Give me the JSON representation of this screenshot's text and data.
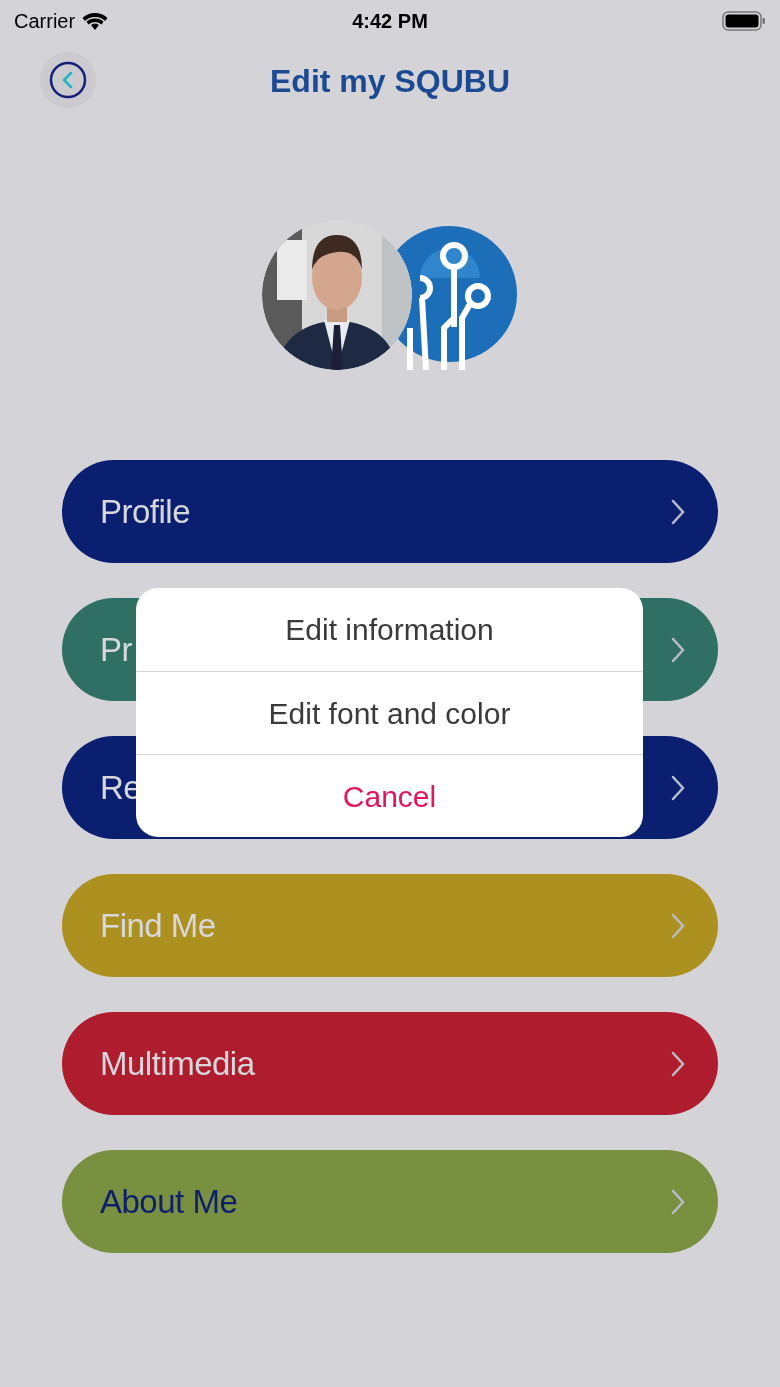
{
  "status_bar": {
    "carrier": "Carrier",
    "time": "4:42 PM"
  },
  "header": {
    "title": "Edit my SQUBU"
  },
  "menu": [
    {
      "label": "Profile",
      "color": "#0b1f70",
      "dark_label": false
    },
    {
      "label": "Pr",
      "color": "#2f6f64",
      "dark_label": false
    },
    {
      "label": "Re",
      "color": "#0b1f70",
      "dark_label": false
    },
    {
      "label": "Find Me",
      "color": "#ad9120",
      "dark_label": false
    },
    {
      "label": "Multimedia",
      "color": "#ae1c2e",
      "dark_label": false
    },
    {
      "label": "About Me",
      "color": "#789040",
      "dark_label": true
    }
  ],
  "action_sheet": {
    "options": [
      {
        "label": "Edit information",
        "kind": "default"
      },
      {
        "label": "Edit font and color",
        "kind": "default"
      },
      {
        "label": "Cancel",
        "kind": "destructive"
      }
    ]
  }
}
